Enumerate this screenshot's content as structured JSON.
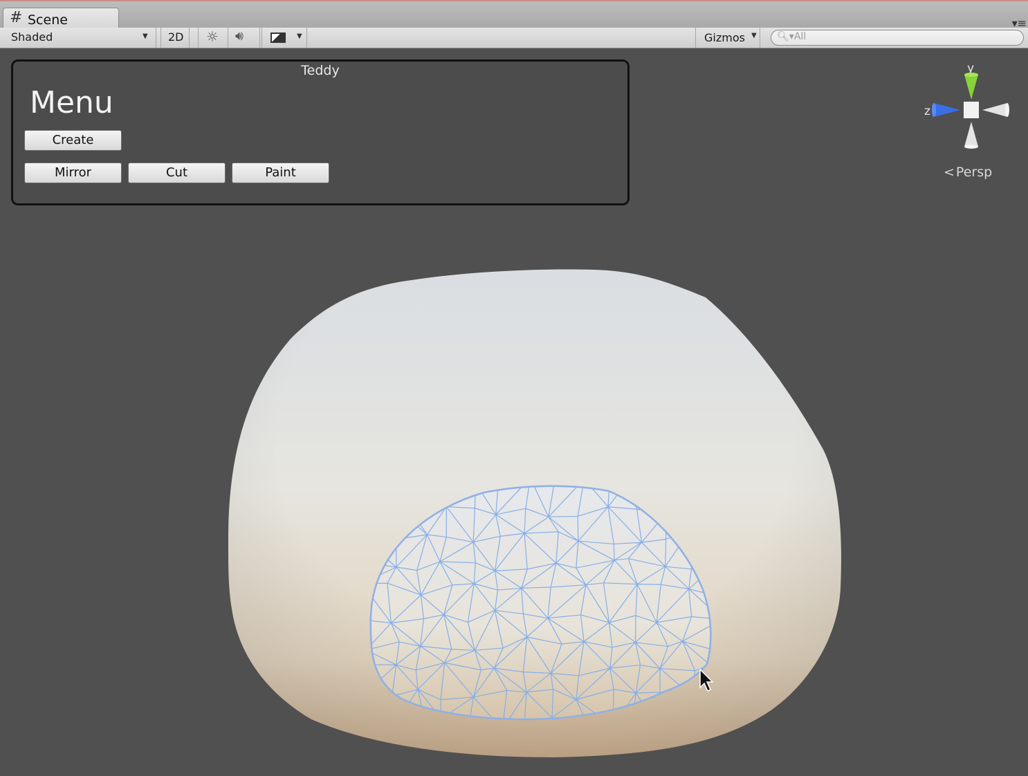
{
  "tab": {
    "title": "Scene",
    "hash_glyph": "#"
  },
  "toolbar": {
    "shading_mode": "Shaded",
    "mode_2d_label": "2D",
    "lighting_icon": "sun-icon",
    "audio_icon": "speaker-icon",
    "effects_icon": "image-icon",
    "gizmos_label": "Gizmos",
    "search_placeholder": "All"
  },
  "menu_panel": {
    "title": "Teddy",
    "heading": "Menu",
    "buttons": {
      "create": "Create",
      "mirror": "Mirror",
      "cut": "Cut",
      "paint": "Paint"
    }
  },
  "gizmo": {
    "y_label": "y",
    "z_label": "z",
    "projection": "Persp",
    "colors": {
      "y": "#8ad43a",
      "z": "#3a6ee8",
      "neutral": "#e6e6e6"
    }
  },
  "colors": {
    "viewport_bg": "#505050",
    "model_top": "#d9dde1",
    "model_bottom": "#d6c0a0",
    "wireframe": "#7aa8f0"
  }
}
